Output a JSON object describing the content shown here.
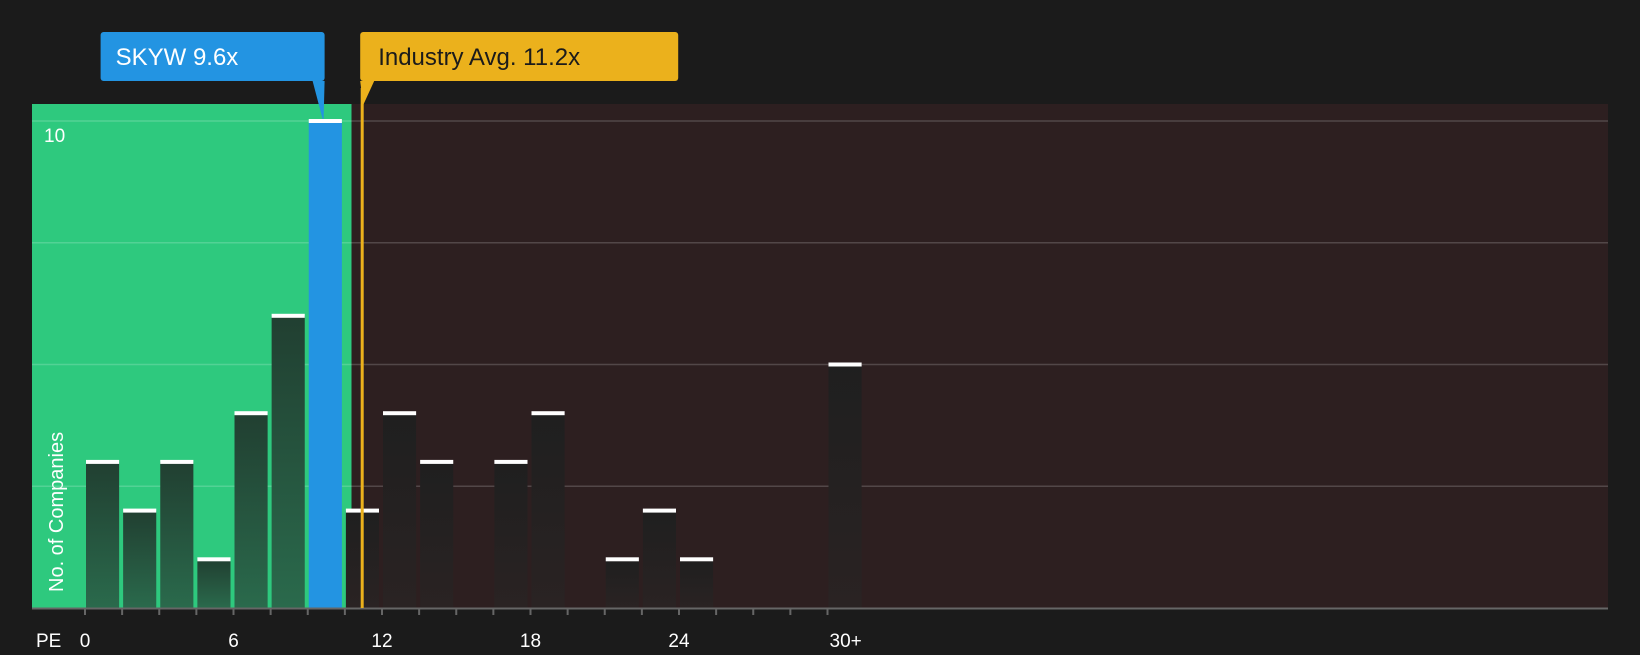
{
  "chart_data": {
    "type": "bar",
    "x_axis_title": "PE",
    "y_axis_title": "No. of Companies",
    "x_ticks": [
      "0",
      "6",
      "12",
      "18",
      "24",
      "30+"
    ],
    "x_tick_values": [
      0,
      6,
      12,
      18,
      24,
      30
    ],
    "y_ticks": [
      "10"
    ],
    "y_tick_values": [
      10
    ],
    "xlim": [
      -1.1,
      30.8
    ],
    "ylim": [
      0,
      10.4
    ],
    "bin_width": 1.5,
    "bins": [
      {
        "x": 0.0,
        "value": 3
      },
      {
        "x": 1.5,
        "value": 2
      },
      {
        "x": 3.0,
        "value": 3
      },
      {
        "x": 4.5,
        "value": 1
      },
      {
        "x": 6.0,
        "value": 4
      },
      {
        "x": 7.5,
        "value": 6
      },
      {
        "x": 9.0,
        "value": 10
      },
      {
        "x": 10.5,
        "value": 2
      },
      {
        "x": 12.0,
        "value": 4
      },
      {
        "x": 13.5,
        "value": 3
      },
      {
        "x": 15.0,
        "value": 0
      },
      {
        "x": 16.5,
        "value": 3
      },
      {
        "x": 18.0,
        "value": 4
      },
      {
        "x": 19.5,
        "value": 0
      },
      {
        "x": 21.0,
        "value": 1
      },
      {
        "x": 22.5,
        "value": 2
      },
      {
        "x": 24.0,
        "value": 1
      },
      {
        "x": 25.5,
        "value": 0
      },
      {
        "x": 27.0,
        "value": 0
      },
      {
        "x": 30.0,
        "value": 5
      }
    ],
    "highlight_bin_x": 9.0,
    "fair_zone_max": 10.75,
    "company": {
      "label": "SKYW 9.6x",
      "value": 9.6
    },
    "industry": {
      "label": "Industry Avg. 11.2x",
      "value": 11.2
    },
    "grid": true,
    "colors": {
      "background": "#1b1b1b",
      "fair_zone": "#2ec97e",
      "over_zone": "#2d1f20",
      "bar_in_fair": "#234a37",
      "bar_in_over": "#252222",
      "bar_cap": "#ffffff",
      "company": "#2394e2",
      "industry": "#ebb11c",
      "gridline": "#ffffff",
      "text": "#ffffff",
      "axis": "#666666"
    }
  }
}
